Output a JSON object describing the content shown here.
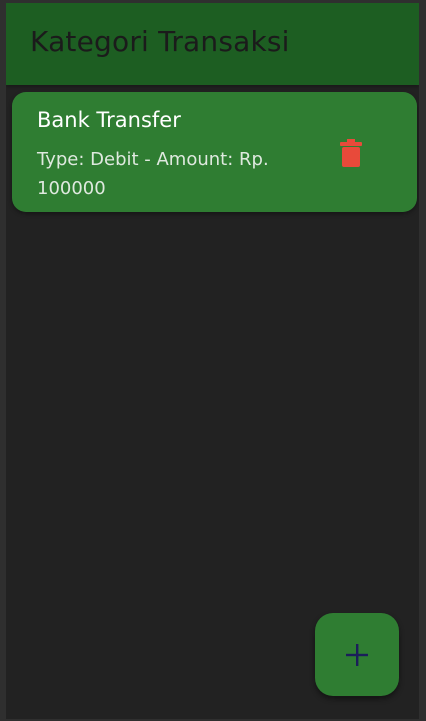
{
  "app_bar": {
    "title": "Kategori Transaksi"
  },
  "categories": [
    {
      "name": "Bank Transfer",
      "subtitle": "Type: Debit - Amount: Rp. 100000",
      "delete_icon": "trash-icon"
    }
  ],
  "fab": {
    "icon": "plus-icon"
  },
  "colors": {
    "app_bar_background": "#1d5e22",
    "screen_background": "#222222",
    "card_background": "#2f7d32",
    "delete_icon": "#e84a3a",
    "fab_icon": "#1b1e5a"
  }
}
